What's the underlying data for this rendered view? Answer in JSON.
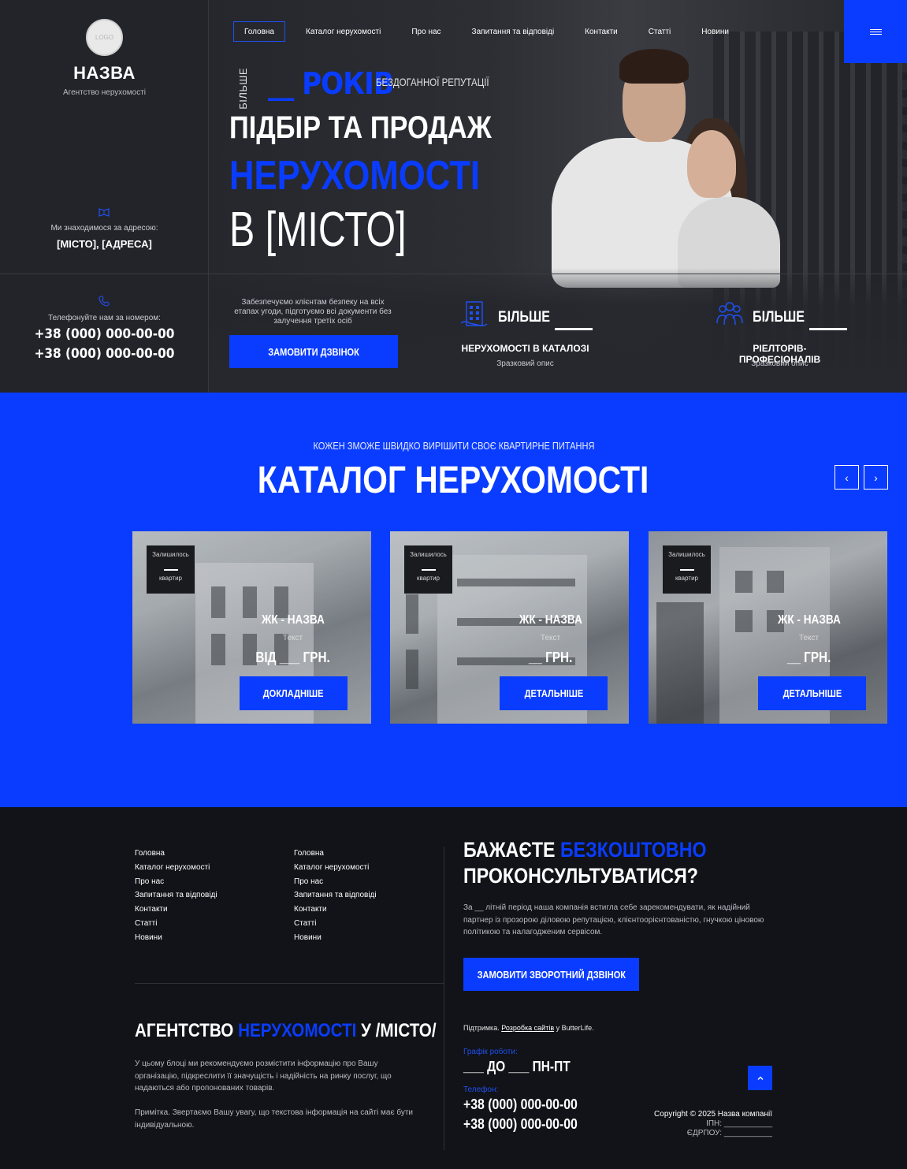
{
  "brand": {
    "logo": "LOGO",
    "name": "НАЗВА",
    "subtitle": "Агентство нерухомості"
  },
  "address": {
    "icon": "map-book-icon",
    "label": "Ми знаходимося за адресою:",
    "value": "[МІСТО], [АДРЕСА]"
  },
  "phone": {
    "icon": "phone-icon",
    "label": "Телефонуйте нам за номером:",
    "numbers": [
      "+38 (000) 000-00-00",
      "+38 (000) 000-00-00"
    ]
  },
  "nav": {
    "items": [
      "Головна",
      "Каталог нерухомості",
      "Про нас",
      "Запитання та відповіді",
      "Контакти",
      "Статті",
      "Новини"
    ],
    "active": "Головна",
    "menu_icon": "hamburger-icon"
  },
  "hero": {
    "more_vertical": "БІЛЬШЕ",
    "years": "__ РОКІВ",
    "reputation": "БЕЗДОГАННОЇ РЕПУТАЦІЇ",
    "title_line1": "ПІДБІР ТА ПРОДАЖ",
    "title_line2": "НЕРУХОМОСТІ",
    "title_line3": "В [МІСТО]",
    "secure_text": "Забезпечуємо клієнтам безпеку на всіх етапах угоди, підготуємо всі документи без залучення третіх осіб",
    "cta": "ЗАМОВИТИ ДЗВІНОК"
  },
  "stats": [
    {
      "icon": "buildings-icon",
      "more": "БІЛЬШЕ",
      "title": "НЕРУХОМОСТІ В КАТАЛОЗІ",
      "desc": "Зразковий опис"
    },
    {
      "icon": "team-icon",
      "more": "БІЛЬШЕ",
      "title": "РІЕЛТОРІВ-ПРОФЕСІОНАЛІВ",
      "desc": "Зразковий опис"
    }
  ],
  "catalog": {
    "subtitle": "КОЖЕН ЗМОЖЕ ШВИДКО ВИРІШИТИ СВОЄ КВАРТИРНЕ ПИТАННЯ",
    "title": "КАТАЛОГ НЕРУХОМОСТІ",
    "prev_icon": "chevron-left-icon",
    "next_icon": "chevron-right-icon",
    "cards": [
      {
        "left_top": "Залишилось",
        "left_bottom": "квартир",
        "name": "ЖК - НАЗВА",
        "text": "Текст",
        "price": "ВІД ___ ГРН.",
        "button": "ДОКЛАДНІШЕ"
      },
      {
        "left_top": "Залишилось",
        "left_bottom": "квартир",
        "name": "ЖК - НАЗВА",
        "text": "Текст",
        "price": "__ ГРН.",
        "button": "ДЕТАЛЬНІШЕ"
      },
      {
        "left_top": "Залишилось",
        "left_bottom": "квартир",
        "name": "ЖК - НАЗВА",
        "text": "Текст",
        "price": "__ ГРН.",
        "button": "ДЕТАЛЬНІШЕ"
      }
    ]
  },
  "footer": {
    "links_col1": [
      "Головна",
      "Каталог нерухомості",
      "Про нас",
      "Запитання та відповіді",
      "Контакти",
      "Статті",
      "Новини"
    ],
    "links_col2": [
      "Головна",
      "Каталог нерухомості",
      "Про нас",
      "Запитання та відповіді",
      "Контакти",
      "Статті",
      "Новини"
    ],
    "agency_a": "АГЕНТСТВО ",
    "agency_b": "НЕРУХОМОСТІ",
    "agency_c": " У /МІСТО/",
    "agency_text": "У цьому блоці ми рекомендуємо розмістити інформацію про Вашу організацію, підкреслити її значущість і надійність на ринку послуг, що надаються або пропонованих товарів.",
    "agency_note": "Примітка. Звертаємо Вашу увагу, що текстова інформація на сайті має бути індивідуальною.",
    "consult_a": "БАЖАЄТЕ ",
    "consult_b": "БЕЗКОШТОВНО",
    "consult_c": "ПРОКОНСУЛЬТУВАТИСЯ?",
    "consult_text": "За __ літній період наша компанія встигла себе зарекомендувати, як надійний партнер із прозорою діловою репутацією, клієнтоорієнтованістю, гнучкою ціновою політикою та налагодженим сервісом.",
    "cta": "ЗАМОВИТИ ЗВОРОТНИЙ ДЗВІНОК",
    "support_prefix": "Підтримка.",
    "support_link": "Розробка сайтів",
    "support_suffix": "у ButterLife.",
    "schedule_label": "Графік роботи:",
    "schedule": "___ ДО ___ ПН-ПТ",
    "tel_label": "Телефон:",
    "tels": [
      "+38 (000) 000-00-00",
      "+38 (000) 000-00-00"
    ],
    "to_top_icon": "chevron-up-icon",
    "copyright": "Copyright © 2025 Назва компанії",
    "ipn": "ІПН: ___________",
    "edrpou": "ЄДРПОУ: ___________"
  }
}
